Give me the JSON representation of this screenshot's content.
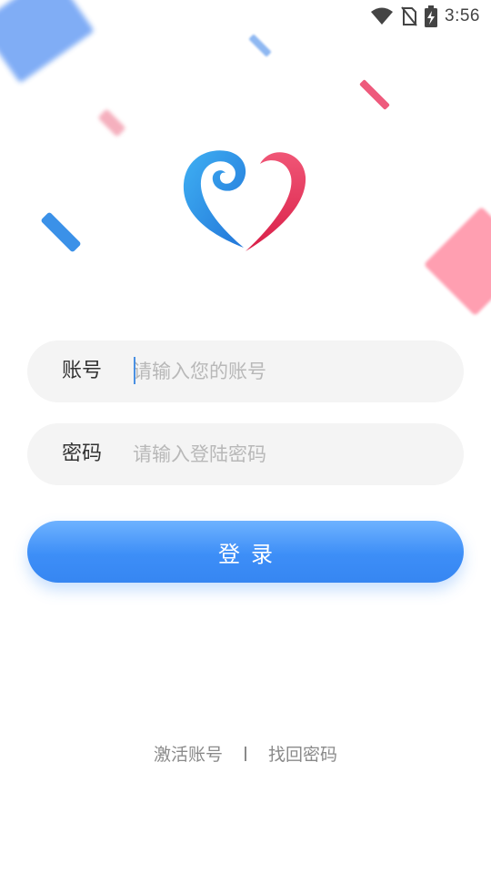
{
  "status_bar": {
    "time": "3:56",
    "icons": [
      "wifi-icon",
      "no-sim-icon",
      "battery-charging-icon"
    ]
  },
  "logo": {
    "icon": "heart-logo-icon",
    "colors": {
      "blue": "#2f8de4",
      "pink": "#e8395f"
    }
  },
  "form": {
    "account": {
      "label": "账号",
      "placeholder": "请输入您的账号",
      "value": ""
    },
    "password": {
      "label": "密码",
      "placeholder": "请输入登陆密码",
      "value": ""
    }
  },
  "login_button": {
    "label": "登录"
  },
  "links": {
    "activate": "激活账号",
    "recover": "找回密码"
  },
  "colors": {
    "accent": "#3d8ef7",
    "field_bg": "#f4f4f4"
  }
}
